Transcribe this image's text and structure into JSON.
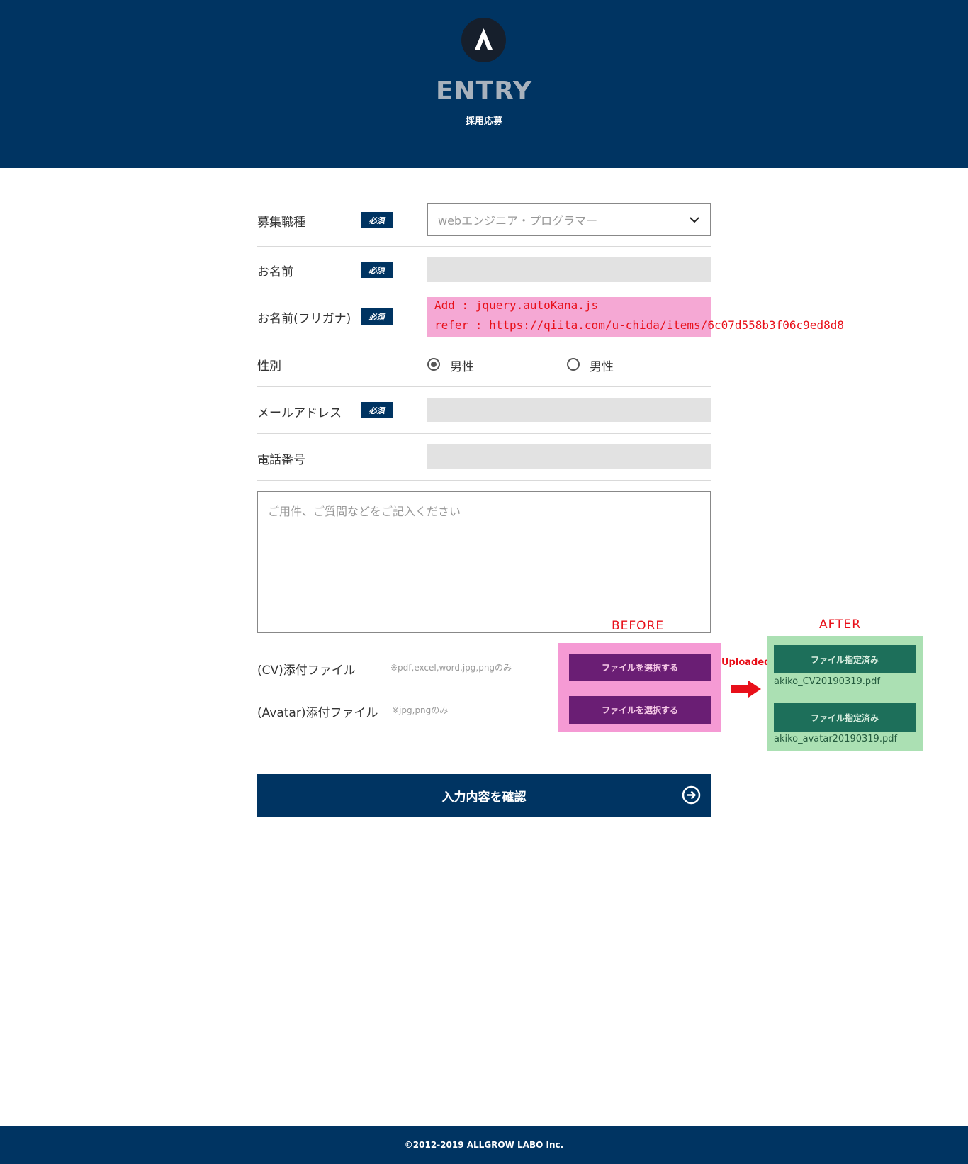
{
  "header": {
    "title": "ENTRY",
    "subtitle": "採用応募"
  },
  "form": {
    "job": {
      "label": "募集職種",
      "required": "必須",
      "selected": "webエンジニア・プログラマー"
    },
    "name": {
      "label": "お名前",
      "required": "必須",
      "value": ""
    },
    "kana": {
      "label": "お名前(フリガナ)",
      "required": "必須",
      "value": ""
    },
    "gender": {
      "label": "性別",
      "options": [
        "男性",
        "男性"
      ],
      "selected_index": 0
    },
    "email": {
      "label": "メールアドレス",
      "required": "必須",
      "value": ""
    },
    "phone": {
      "label": "電話番号",
      "value": ""
    },
    "message": {
      "placeholder": "ご用件、ご質問などをご記入ください"
    },
    "cv": {
      "label": "(CV)添付ファイル",
      "hint": "※pdf,excel,word,jpg,pngのみ"
    },
    "avatar": {
      "label": "(Avatar)添付ファイル",
      "hint": "※jpg,pngのみ"
    },
    "submit": {
      "label": "入力内容を確認",
      "icon": "arrow-circle-right-icon"
    }
  },
  "annotation": {
    "line1": "Add : jquery.autoKana.js",
    "line2": "refer : https://qiita.com/u-chida/items/6c07d558b3f06c9ed8d8",
    "before_label": "BEFORE",
    "after_label": "AFTER",
    "uploaded_label": "Uploaded",
    "select_button": "ファイルを選択する",
    "selected_button": "ファイル指定済み",
    "cv_filename": "akiko_CV20190319.pdf",
    "avatar_filename": "akiko_avatar20190319.pdf"
  },
  "footer": {
    "copyright": "©2012-2019 ALLGROW LABO Inc."
  },
  "colors": {
    "navy": "#003462",
    "annotation_red": "#e8101a",
    "before_pink": "#f59ad4",
    "button_purple": "#6a1e74",
    "after_green": "#abe0b3",
    "button_green": "#1d6f5a"
  }
}
